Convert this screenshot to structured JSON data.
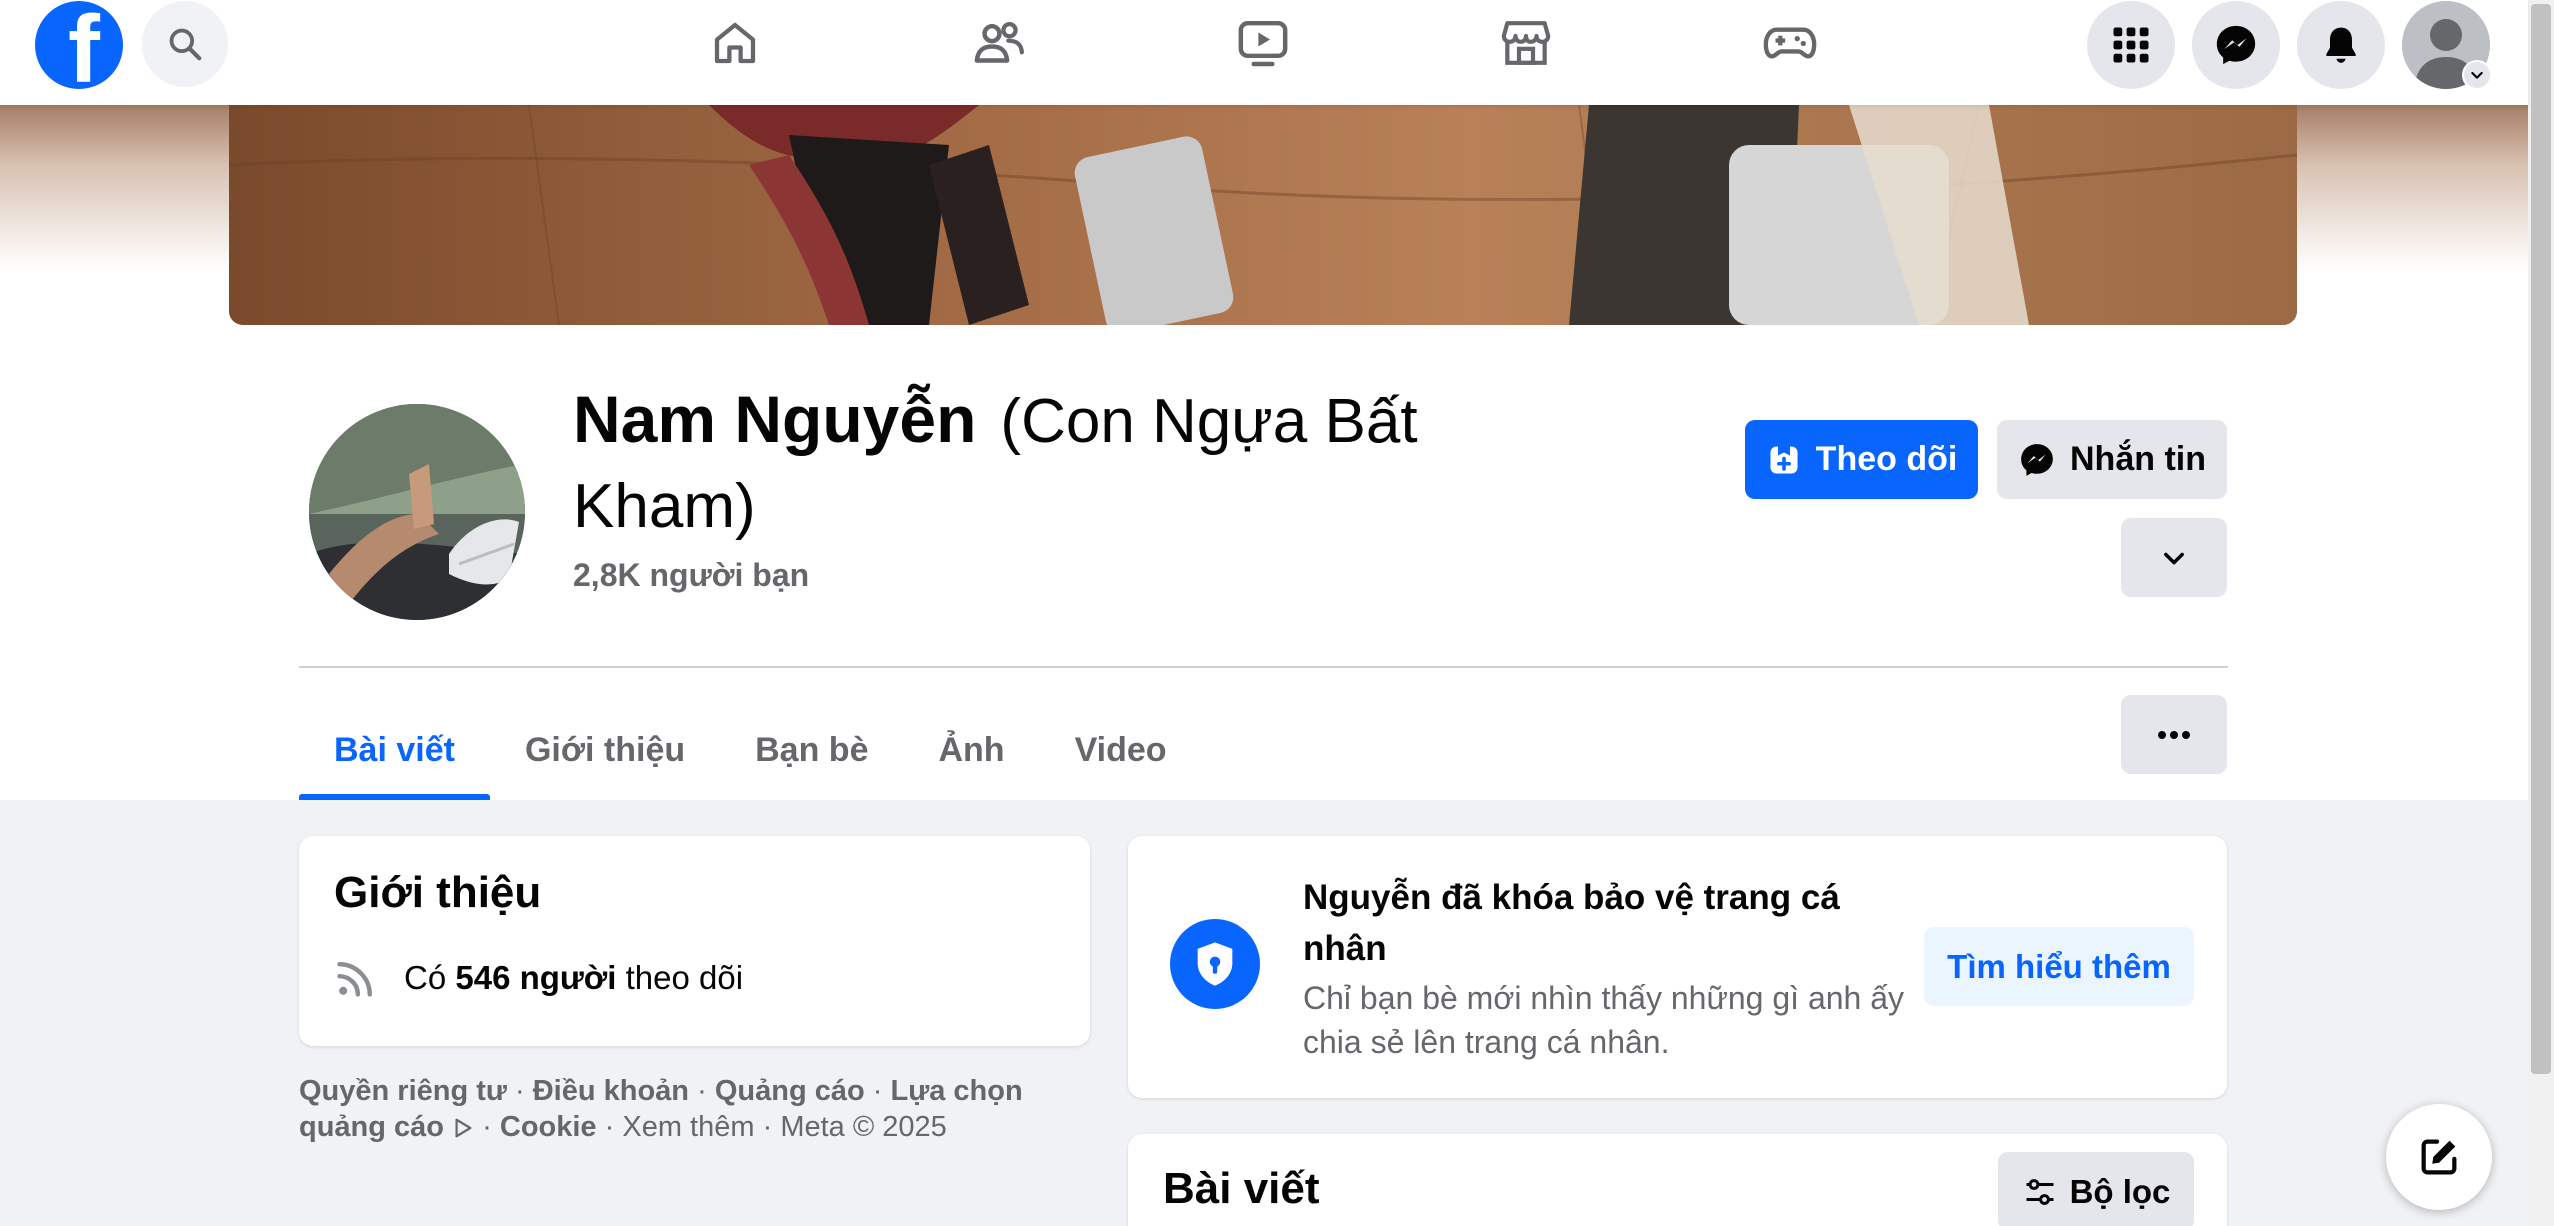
{
  "topbar": {
    "logo_icon": "facebook-logo",
    "search_icon": "search-icon",
    "nav_icons": [
      "home-icon",
      "friends-icon",
      "watch-icon",
      "marketplace-icon",
      "gaming-icon"
    ],
    "right_icons": [
      "menu-grid-icon",
      "messenger-icon",
      "notifications-icon",
      "account-avatar"
    ]
  },
  "profile": {
    "name": "Nam Nguyễn",
    "alternate_name": "(Con Ngựa Bất Kham)",
    "friends": "2,8K người bạn",
    "follow_label": "Theo dõi",
    "message_label": "Nhắn tin"
  },
  "tabs": [
    {
      "label": "Bài viết",
      "active": true
    },
    {
      "label": "Giới thiệu",
      "active": false
    },
    {
      "label": "Bạn bè",
      "active": false
    },
    {
      "label": "Ảnh",
      "active": false
    },
    {
      "label": "Video",
      "active": false
    }
  ],
  "intro": {
    "title": "Giới thiệu",
    "followers_prefix": "Có",
    "followers_count": "546 người",
    "followers_suffix": "theo dõi"
  },
  "footer": {
    "privacy": "Quyền riêng tư",
    "terms": "Điều khoản",
    "ads": "Quảng cáo",
    "ad_choices": "Lựa chọn quảng cáo",
    "cookie": "Cookie",
    "see_more": "Xem thêm",
    "copyright": "Meta © 2025",
    "sep": "·"
  },
  "locked": {
    "title": "Nguyễn đã khóa bảo vệ trang cá nhân",
    "description": "Chỉ bạn bè mới nhìn thấy những gì anh ấy chia sẻ lên trang cá nhân.",
    "learn_more": "Tìm hiểu thêm"
  },
  "posts": {
    "title": "Bài viết",
    "filter_label": "Bộ lọc"
  },
  "colors": {
    "accent": "#0866ff",
    "secondary_text": "#65676b",
    "button_gray": "#e4e6eb",
    "page_bg": "#f0f2f5"
  }
}
